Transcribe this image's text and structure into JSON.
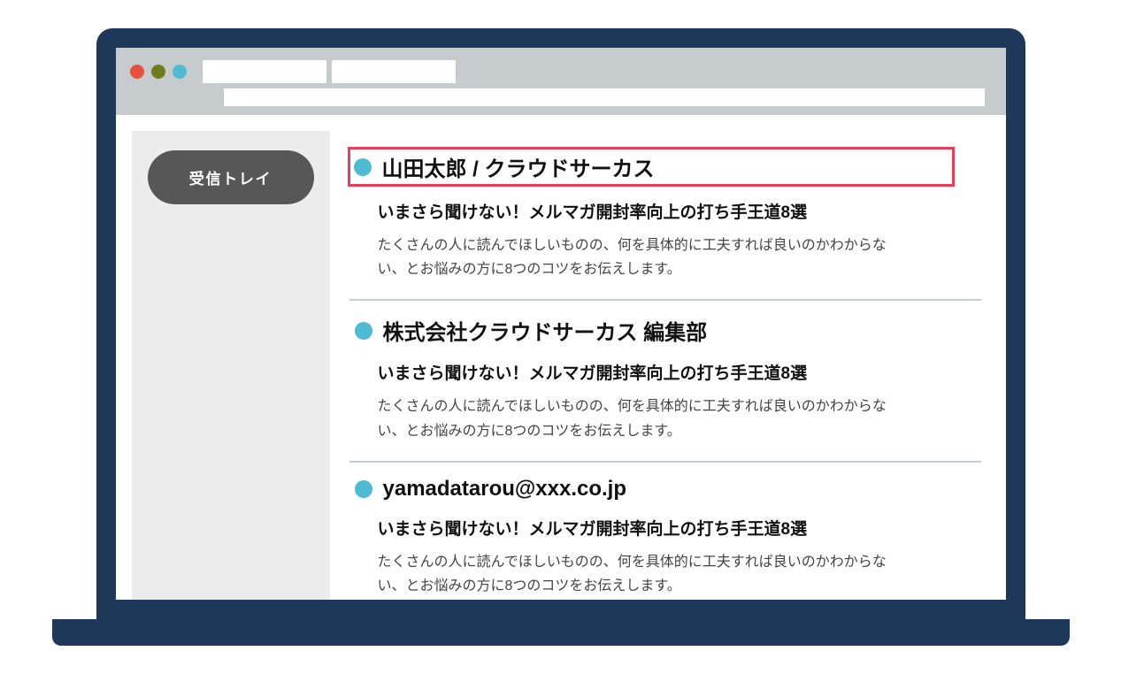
{
  "colors": {
    "laptop": "#1E3859",
    "chrome_bg": "#C6CBCE",
    "traffic_red": "#E94F3D",
    "traffic_olive": "#6E7E1E",
    "traffic_cyan": "#4FBBD2",
    "sidebar_bg": "#ECECEC",
    "pill_bg": "#575757",
    "highlight_border": "#E73E5A",
    "dot": "#4FBBD2"
  },
  "sidebar": {
    "inbox_label": "受信トレイ"
  },
  "emails": [
    {
      "sender": "山田太郎 / クラウドサーカス",
      "highlighted": true,
      "subject": "いまさら聞けない！メルマガ開封率向上の打ち手王道8選",
      "preview": "たくさんの人に読んでほしいものの、何を具体的に工夫すれば良いのかわからない、とお悩みの方に8つのコツをお伝えします。"
    },
    {
      "sender": "株式会社クラウドサーカス 編集部",
      "highlighted": false,
      "subject": "いまさら聞けない！メルマガ開封率向上の打ち手王道8選",
      "preview": "たくさんの人に読んでほしいものの、何を具体的に工夫すれば良いのかわからない、とお悩みの方に8つのコツをお伝えします。"
    },
    {
      "sender": "yamadatarou@xxx.co.jp",
      "highlighted": false,
      "subject": "いまさら聞けない！メルマガ開封率向上の打ち手王道8選",
      "preview": "たくさんの人に読んでほしいものの、何を具体的に工夫すれば良いのかわからない、とお悩みの方に8つのコツをお伝えします。"
    }
  ]
}
